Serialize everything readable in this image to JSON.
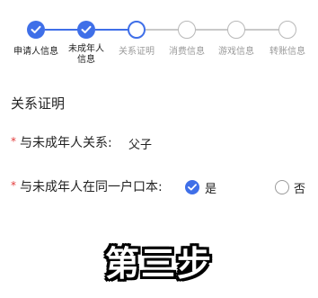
{
  "stepper": {
    "accent_color": "#3f6fe8",
    "steps": [
      {
        "label": "申请人信息",
        "state": "done",
        "icon": "check-icon"
      },
      {
        "label": "未成年人\n信息",
        "state": "done",
        "icon": "check-icon"
      },
      {
        "label": "关系证明",
        "state": "current"
      },
      {
        "label": "消费信息",
        "state": "todo"
      },
      {
        "label": "游戏信息",
        "state": "todo"
      },
      {
        "label": "转账信息",
        "state": "todo"
      }
    ]
  },
  "section": {
    "title": "关系证明"
  },
  "fields": {
    "relation": {
      "label": "与未成年人关系:",
      "value": "父子"
    },
    "same_household": {
      "label": "与未成年人在同一户口本:",
      "options": [
        {
          "label": "是",
          "selected": true
        },
        {
          "label": "否",
          "selected": false
        }
      ]
    }
  },
  "overlay": {
    "text": "第三步"
  }
}
